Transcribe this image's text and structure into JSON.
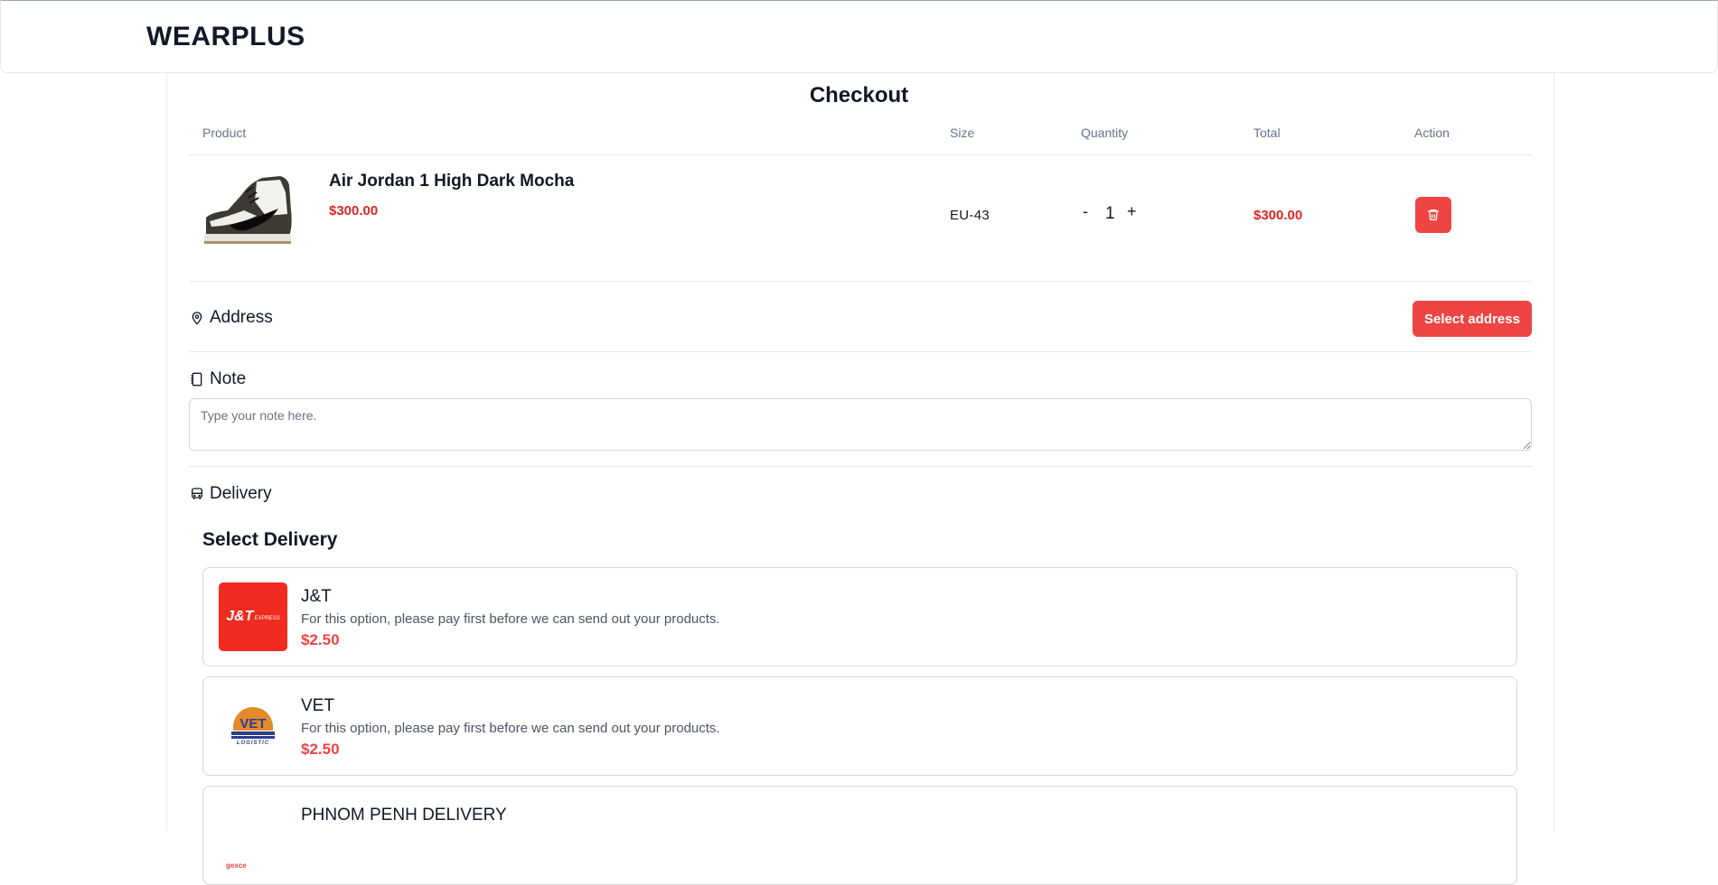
{
  "brand": "WEARPLUS",
  "page_title": "Checkout",
  "table": {
    "headers": {
      "product": "Product",
      "size": "Size",
      "quantity": "Quantity",
      "total": "Total",
      "action": "Action"
    },
    "row": {
      "name": "Air Jordan 1 High Dark Mocha",
      "price": "$300.00",
      "size": "EU-43",
      "minus": "-",
      "quantity": "1",
      "plus": "+",
      "total": "$300.00"
    }
  },
  "address": {
    "label": "Address",
    "button": "Select address"
  },
  "note": {
    "label": "Note",
    "placeholder": "Type your note here."
  },
  "delivery": {
    "label": "Delivery",
    "heading": "Select Delivery",
    "options": [
      {
        "name": "J&T",
        "desc": "For this option, please pay first before we can send out your products.",
        "price": "$2.50",
        "logo_text": "J&T",
        "logo_sub": "EXPRESS"
      },
      {
        "name": "VET",
        "desc": "For this option, please pay first before we can send out your products.",
        "price": "$2.50",
        "logo_text": "VET",
        "logo_sub": "LOGISTIC"
      },
      {
        "name": "PHNOM PENH DELIVERY",
        "logo_text": "gexce"
      }
    ]
  },
  "colors": {
    "accent_red": "#ef4444",
    "price_red": "#dc2626",
    "jt_red": "#ef2c1f"
  }
}
